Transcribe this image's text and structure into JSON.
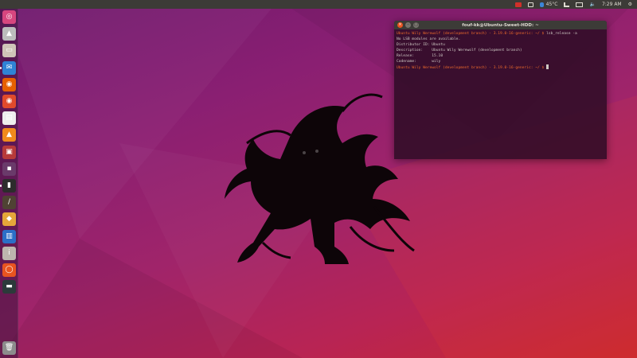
{
  "top_panel": {
    "battery": "45°C",
    "clock": "7:29 AM",
    "indicators": [
      "mail-icon",
      "keyboard-icon",
      "network-icon",
      "battery-icon",
      "volume-icon",
      "settings-gear-icon"
    ]
  },
  "launcher": {
    "items": [
      {
        "name": "dash-home-icon",
        "color": "#d7467f"
      },
      {
        "name": "privacy-app-icon",
        "color": "#bcbcbc"
      },
      {
        "name": "files-icon",
        "color": "#cfc4b8"
      },
      {
        "name": "thunderbird-icon",
        "color": "#2f83d5"
      },
      {
        "name": "firefox-icon",
        "color": "#e66000"
      },
      {
        "name": "chrome-icon",
        "color": "#e04a2b"
      },
      {
        "name": "document-viewer-icon",
        "color": "#eeeeee"
      },
      {
        "name": "vlc-icon",
        "color": "#f08a1c"
      },
      {
        "name": "popcorn-time-icon",
        "color": "#b73a3a"
      },
      {
        "name": "desktop-icon",
        "color": "#6a3a6a"
      },
      {
        "name": "terminal-icon",
        "color": "#2c2c2c"
      },
      {
        "name": "text-editor-icon",
        "color": "#4f4233"
      },
      {
        "name": "guake-icon",
        "color": "#e5a73a"
      },
      {
        "name": "system-monitor-icon",
        "color": "#2b6fc7"
      },
      {
        "name": "info-icon",
        "color": "#bdb6ae"
      },
      {
        "name": "ubuntu-software-icon",
        "color": "#e95420"
      },
      {
        "name": "screen-terminal-icon",
        "color": "#2c3a3a"
      },
      {
        "name": "trash-icon",
        "color": "#8c8c8c"
      }
    ]
  },
  "terminal": {
    "title": "fouf-kk@Ubuntu-Sweet-HDD: ~",
    "lines": [
      {
        "prompt": "Ubuntu Wily Werewolf (development branch) - 3.19.0-16-generic: ~/ $ ",
        "text": "lsb_release -a"
      },
      {
        "prompt": "",
        "text": "No LSB modules are available."
      },
      {
        "prompt": "",
        "text": "Distributor ID: Ubuntu"
      },
      {
        "prompt": "",
        "text": "Description:    Ubuntu Wily Werewolf (development branch)"
      },
      {
        "prompt": "",
        "text": "Release:        15.10"
      },
      {
        "prompt": "",
        "text": "Codename:       wily"
      },
      {
        "prompt": "Ubuntu Wily Werewolf (development branch) - 3.19.0-16-generic: ~/ $ ",
        "text": ""
      }
    ]
  },
  "colors": {
    "accent": "#e95420",
    "panel": "#3c3b37",
    "prompt": "#ec6a2c"
  }
}
